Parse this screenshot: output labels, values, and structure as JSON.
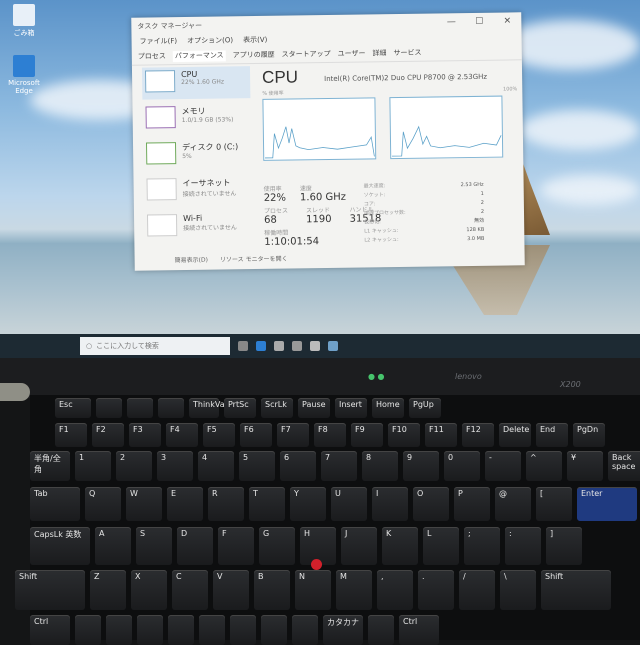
{
  "desktop": {
    "icons": [
      {
        "label": "ごみ箱",
        "icon": "recycle-bin-icon"
      },
      {
        "label": "Microsoft Edge",
        "icon": "edge-icon"
      }
    ]
  },
  "task_manager": {
    "title": "タスク マネージャー",
    "menu": [
      "ファイル(F)",
      "オプション(O)",
      "表示(V)"
    ],
    "tabs": [
      "プロセス",
      "パフォーマンス",
      "アプリの履歴",
      "スタートアップ",
      "ユーザー",
      "詳細",
      "サービス"
    ],
    "active_tab": "パフォーマンス",
    "sidebar": [
      {
        "label": "CPU",
        "sub": "22% 1.60 GHz",
        "active": true
      },
      {
        "label": "メモリ",
        "sub": "1.0/1.9 GB (53%)"
      },
      {
        "label": "ディスク 0 (C:)",
        "sub": "5%"
      },
      {
        "label": "イーサネット",
        "sub": "接続されていません"
      },
      {
        "label": "Wi-Fi",
        "sub": "接続されていません"
      }
    ],
    "main": {
      "heading": "CPU",
      "cpu_name": "Intel(R) Core(TM)2 Duo CPU P8700 @ 2.53GHz",
      "graph_label": "% 使用率",
      "graph_max": "100%",
      "stats": [
        {
          "label": "使用率",
          "value": "22%"
        },
        {
          "label": "速度",
          "value": "1.60 GHz"
        },
        {
          "label": "プロセス",
          "value": "68"
        },
        {
          "label": "スレッド",
          "value": "1190"
        },
        {
          "label": "ハンドル",
          "value": "31518"
        },
        {
          "label": "稼働時間",
          "value": "1:10:01:54"
        }
      ],
      "details": [
        {
          "label": "最大速度:",
          "value": "2.53 GHz"
        },
        {
          "label": "ソケット:",
          "value": "1"
        },
        {
          "label": "コア:",
          "value": "2"
        },
        {
          "label": "論理プロセッサ数:",
          "value": "2"
        },
        {
          "label": "仮想化:",
          "value": "無効"
        },
        {
          "label": "L1 キャッシュ:",
          "value": "128 KB"
        },
        {
          "label": "L2 キャッシュ:",
          "value": "3.0 MB"
        }
      ]
    },
    "footer": {
      "fewer": "簡易表示(D)",
      "monitor": "リソース モニターを開く"
    }
  },
  "taskbar": {
    "search_placeholder": "ここに入力して検索"
  },
  "bezel": {
    "brand": "lenovo",
    "model": "X200"
  },
  "keyboard": {
    "rows": [
      [
        "Esc",
        "",
        "",
        "",
        "ThinkVantage",
        "PrtSc",
        "ScrLk",
        "Pause",
        "Insert",
        "Home",
        "PgUp"
      ],
      [
        "F1",
        "F2",
        "F3",
        "F4",
        "F5",
        "F6",
        "F7",
        "F8",
        "F9",
        "F10",
        "F11",
        "F12",
        "Delete",
        "End",
        "PgDn"
      ],
      [
        "半角/全角",
        "1",
        "2",
        "3",
        "4",
        "5",
        "6",
        "7",
        "8",
        "9",
        "0",
        "-",
        "^",
        "¥",
        "Back space"
      ],
      [
        "Tab",
        "Q",
        "W",
        "E",
        "R",
        "T",
        "Y",
        "U",
        "I",
        "O",
        "P",
        "@",
        "[",
        "Enter"
      ],
      [
        "CapsLk 英数",
        "A",
        "S",
        "D",
        "F",
        "G",
        "H",
        "J",
        "K",
        "L",
        ";",
        ":",
        "]"
      ],
      [
        "Shift",
        "Z",
        "X",
        "C",
        "V",
        "B",
        "N",
        "M",
        ",",
        ".",
        "/",
        "\\",
        "Shift"
      ],
      [
        "Ctrl",
        "",
        "",
        "",
        "",
        "",
        "",
        "",
        "",
        "カタカナ",
        "",
        "Ctrl"
      ]
    ]
  }
}
